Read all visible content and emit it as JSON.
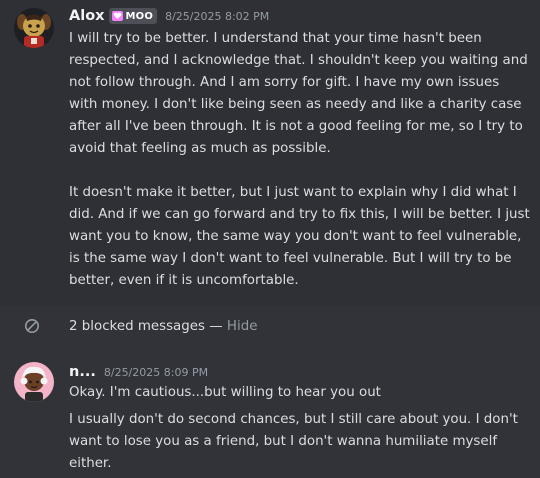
{
  "messages": [
    {
      "author": "Alox",
      "tag": "MOO",
      "timestamp": "8/25/2025 8:02 PM",
      "paragraphs": [
        "I will try to be better. I understand that your time hasn't been respected, and I acknowledge that. I shouldn't keep you waiting and not follow through. And I am sorry for gift. I have my own issues with money. I don't like being seen as needy and like a charity case after all I've been through. It is not a good feeling for me, so I try to avoid that feeling as much as possible.",
        "It doesn't make it better, but I just want to explain why I did what I did. And if we can go forward and try to fix this, I will be better. I just want you to know, the same way you don't want to feel vulnerable, is the same way I don't want to feel vulnerable. But I will try to be better, even if it is uncomfortable."
      ]
    },
    {
      "author": "n...",
      "timestamp": "8/25/2025 8:09 PM",
      "paragraphs": [
        "Okay. I'm cautious...but willing to hear you out",
        "I usually don't do second chances, but I still care about you. I don't want to lose you as a friend, but I don't wanna humiliate myself either."
      ]
    }
  ],
  "blocked": {
    "text": "2 blocked messages",
    "separator": "—",
    "hide_label": "Hide"
  },
  "icons": {
    "tag_icon": "heart-badge-icon",
    "blocked_icon": "blocked-circle-icon"
  },
  "colors": {
    "background": "#313338",
    "highlight_background": "#2e3035",
    "username": "#f2f3f5",
    "text": "#dbdee1",
    "muted": "#949ba4",
    "tag_background": "#4e5058",
    "tag_heart": "#f47fff"
  }
}
